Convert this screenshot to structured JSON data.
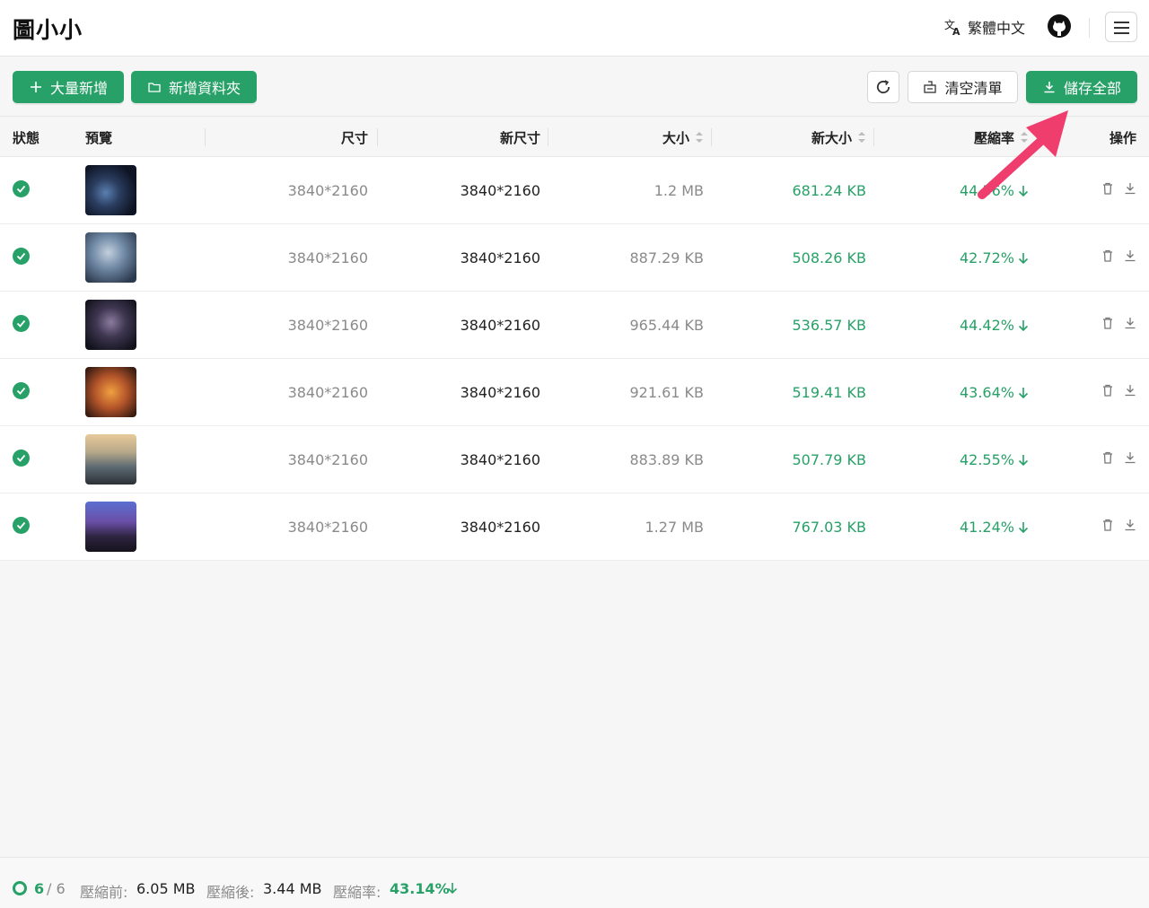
{
  "header": {
    "logo": "圖小小",
    "language_label": "繁體中文",
    "icons": [
      "translate-icon",
      "github-icon",
      "hamburger-menu-icon"
    ]
  },
  "toolbar": {
    "bulk_add_label": "大量新增",
    "add_folder_label": "新增資料夾",
    "clear_list_label": "清空清單",
    "save_all_label": "儲存全部"
  },
  "table": {
    "columns": [
      "狀態",
      "預覽",
      "尺寸",
      "新尺寸",
      "大小",
      "新大小",
      "壓縮率",
      "操作"
    ],
    "rows": [
      {
        "dimensions": "3840*2160",
        "new_dimensions": "3840*2160",
        "size": "1.2 MB",
        "new_size": "681.24 KB",
        "rate": "44.56%"
      },
      {
        "dimensions": "3840*2160",
        "new_dimensions": "3840*2160",
        "size": "887.29 KB",
        "new_size": "508.26 KB",
        "rate": "42.72%"
      },
      {
        "dimensions": "3840*2160",
        "new_dimensions": "3840*2160",
        "size": "965.44 KB",
        "new_size": "536.57 KB",
        "rate": "44.42%"
      },
      {
        "dimensions": "3840*2160",
        "new_dimensions": "3840*2160",
        "size": "921.61 KB",
        "new_size": "519.41 KB",
        "rate": "43.64%"
      },
      {
        "dimensions": "3840*2160",
        "new_dimensions": "3840*2160",
        "size": "883.89 KB",
        "new_size": "507.79 KB",
        "rate": "42.55%"
      },
      {
        "dimensions": "3840*2160",
        "new_dimensions": "3840*2160",
        "size": "1.27 MB",
        "new_size": "767.03 KB",
        "rate": "41.24%"
      }
    ]
  },
  "footer": {
    "done_count": "6",
    "total": "/ 6",
    "before_label": "壓縮前:",
    "before_value": "6.05 MB",
    "after_label": "壓縮後:",
    "after_value": "3.44 MB",
    "rate_label": "壓縮率:",
    "rate_value": "43.14%"
  },
  "colors": {
    "accent": "#27a167",
    "annotation_arrow": "#ef3e6e"
  }
}
